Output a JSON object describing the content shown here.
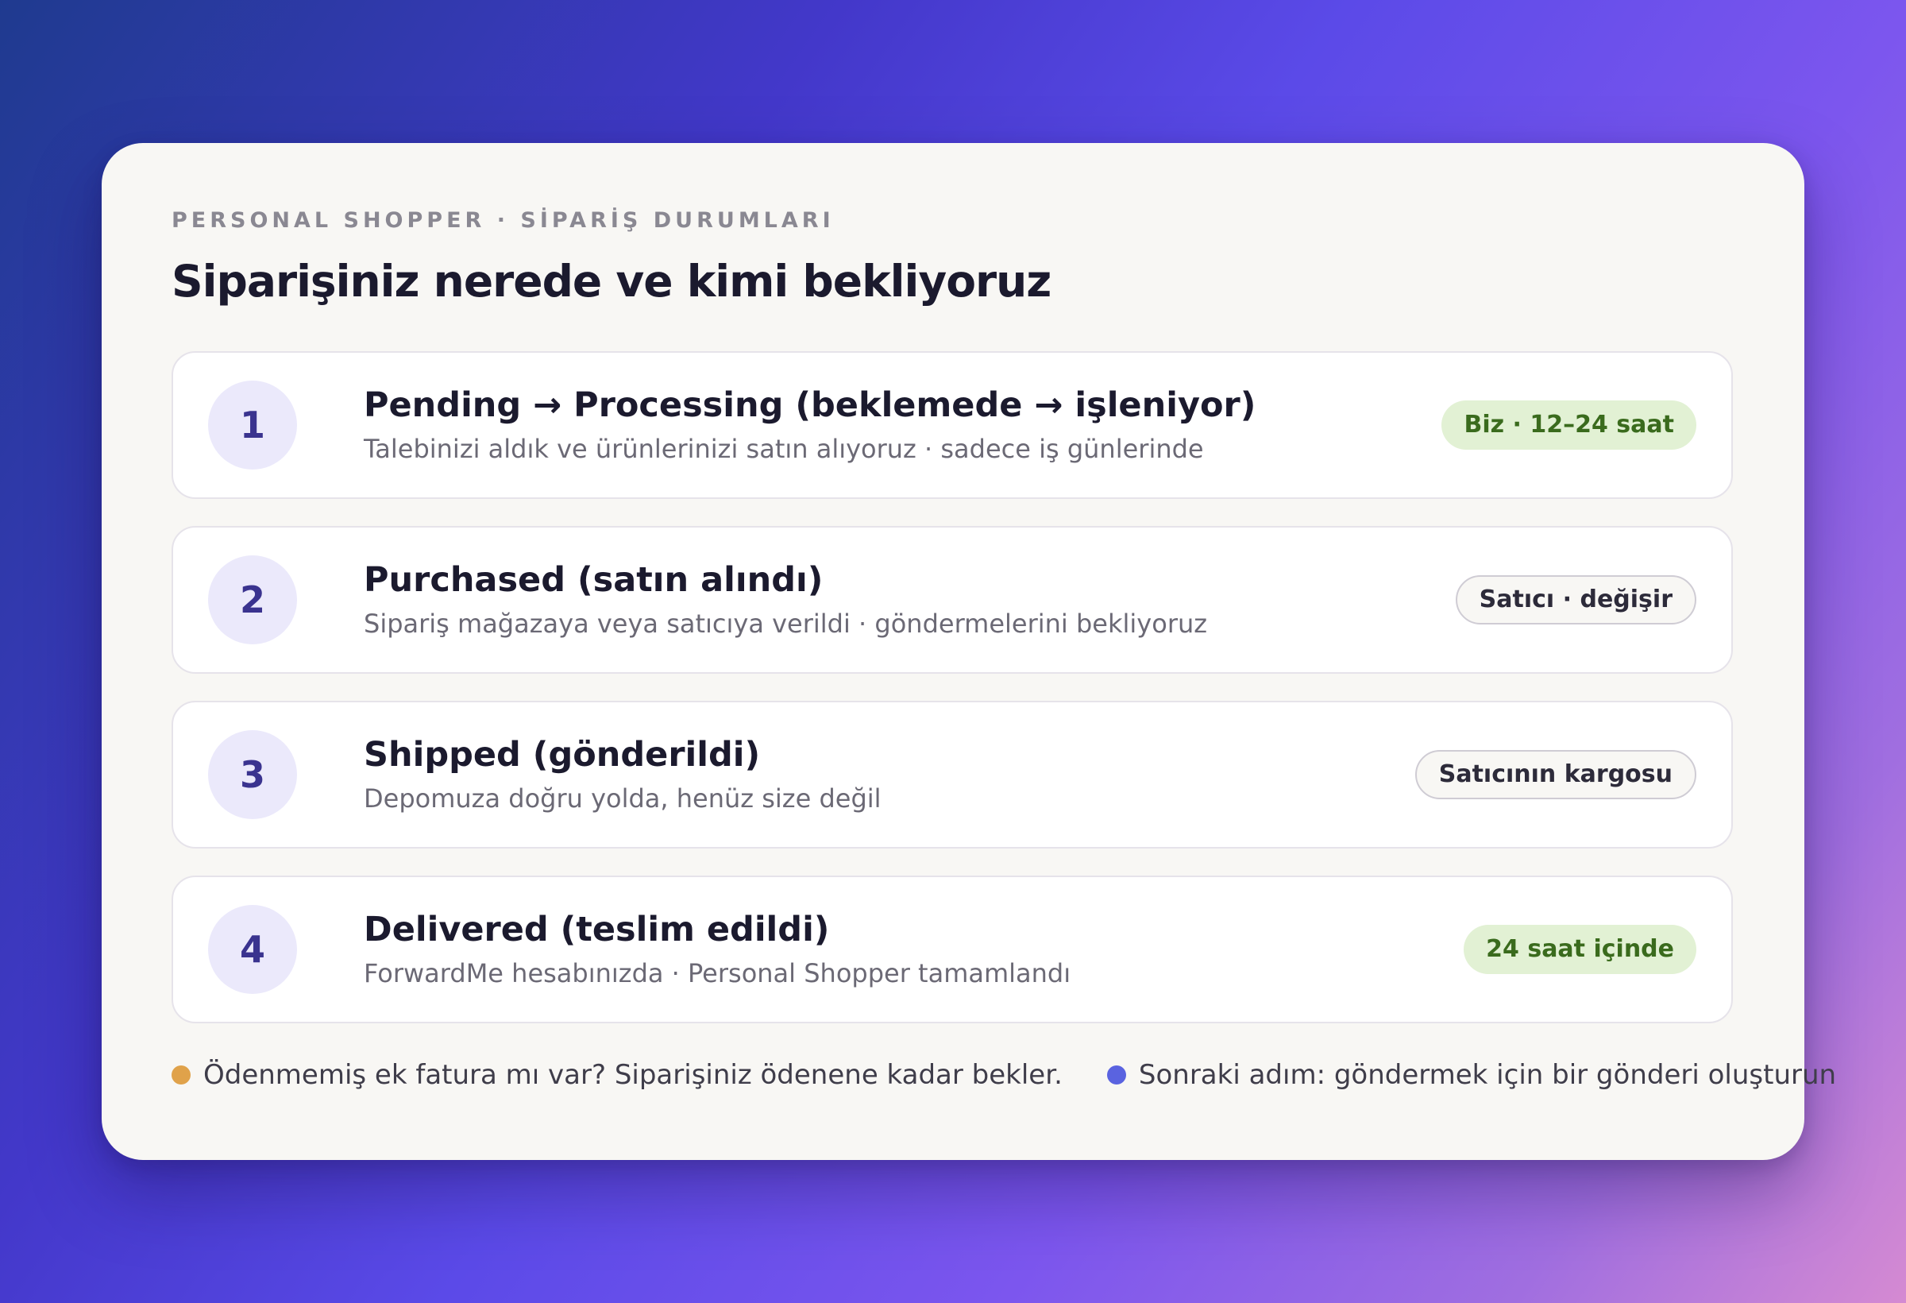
{
  "header": {
    "eyebrow": "PERSONAL SHOPPER · SİPARİŞ DURUMLARI",
    "title": "Siparişiniz nerede ve kimi bekliyoruz"
  },
  "steps": [
    {
      "number": "1",
      "title": "Pending → Processing (beklemede → işleniyor)",
      "subtitle": "Talebinizi aldık ve ürünlerinizi satın alıyoruz · sadece iş günlerinde",
      "badge": "Biz · 12–24 saat",
      "badge_style": "green"
    },
    {
      "number": "2",
      "title": "Purchased (satın alındı)",
      "subtitle": "Sipariş mağazaya veya satıcıya verildi · göndermelerini bekliyoruz",
      "badge": "Satıcı · değişir",
      "badge_style": "outline"
    },
    {
      "number": "3",
      "title": "Shipped (gönderildi)",
      "subtitle": "Depomuza doğru yolda, henüz size değil",
      "badge": "Satıcının kargosu",
      "badge_style": "outline"
    },
    {
      "number": "4",
      "title": "Delivered (teslim edildi)",
      "subtitle": "ForwardMe hesabınızda · Personal Shopper tamamlandı",
      "badge": "24 saat içinde",
      "badge_style": "green"
    }
  ],
  "footer": {
    "notes": [
      {
        "text": "Ödenmemiş ek fatura mı var? Siparişiniz ödenene kadar bekler.",
        "dot_color": "#e0a24a"
      },
      {
        "text": "Sonraki adım: göndermek için bir gönderi oluşturun",
        "dot_color": "#5a63e0"
      }
    ]
  },
  "colors": {
    "card_background": "#f8f7f4",
    "accent": "#3a338f",
    "badge_green_bg": "#e2f1d4",
    "badge_green_text": "#3a6b1d"
  }
}
